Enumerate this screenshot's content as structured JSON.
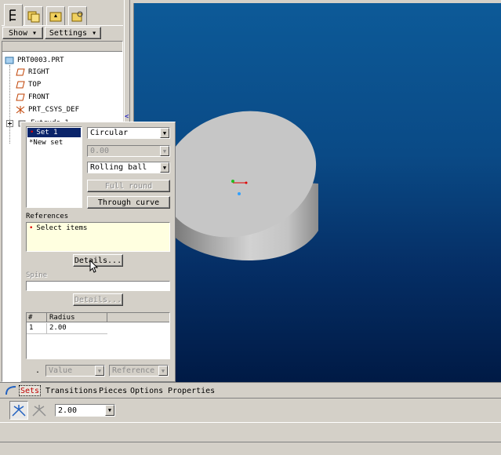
{
  "navigator": {
    "tabs": [
      {
        "icon": "model-tree-icon"
      },
      {
        "icon": "folder-browser-icon"
      },
      {
        "icon": "favorites-icon"
      },
      {
        "icon": "connections-icon"
      }
    ],
    "show_label": "Show ▾",
    "settings_label": "Settings ▾",
    "tree": [
      {
        "label": "PRT0003.PRT",
        "icon": "part-icon"
      },
      {
        "label": "RIGHT",
        "icon": "datum-plane-icon"
      },
      {
        "label": "TOP",
        "icon": "datum-plane-icon"
      },
      {
        "label": "FRONT",
        "icon": "datum-plane-icon"
      },
      {
        "label": "PRT_CSYS_DEF",
        "icon": "csys-icon"
      },
      {
        "label": "Extrude 1",
        "icon": "extrude-icon"
      }
    ]
  },
  "sets_panel": {
    "sets": [
      "Set 1",
      "*New set"
    ],
    "shape_type": "Circular",
    "dimension_value": "0.00",
    "method": "Rolling ball",
    "full_round_label": "Full round",
    "through_curve_label": "Through curve",
    "references_label": "References",
    "references_placeholder": "Select items",
    "details_label": "Details...",
    "spine_label": "Spine",
    "spine_details_label": "Details...",
    "radius_table": {
      "headers": [
        "#",
        "Radius"
      ],
      "rows": [
        [
          "1",
          "2.00"
        ]
      ]
    },
    "value_label": "Value",
    "reference_label": "Reference"
  },
  "dashboard": {
    "tabs": [
      "Sets",
      "Transitions",
      "Pieces",
      "Options",
      "Properties"
    ],
    "radius_value": "2.00"
  },
  "colors": {
    "viewport_top": "#0d5a98",
    "viewport_bottom": "#001a45",
    "selection": "#0a246a"
  }
}
